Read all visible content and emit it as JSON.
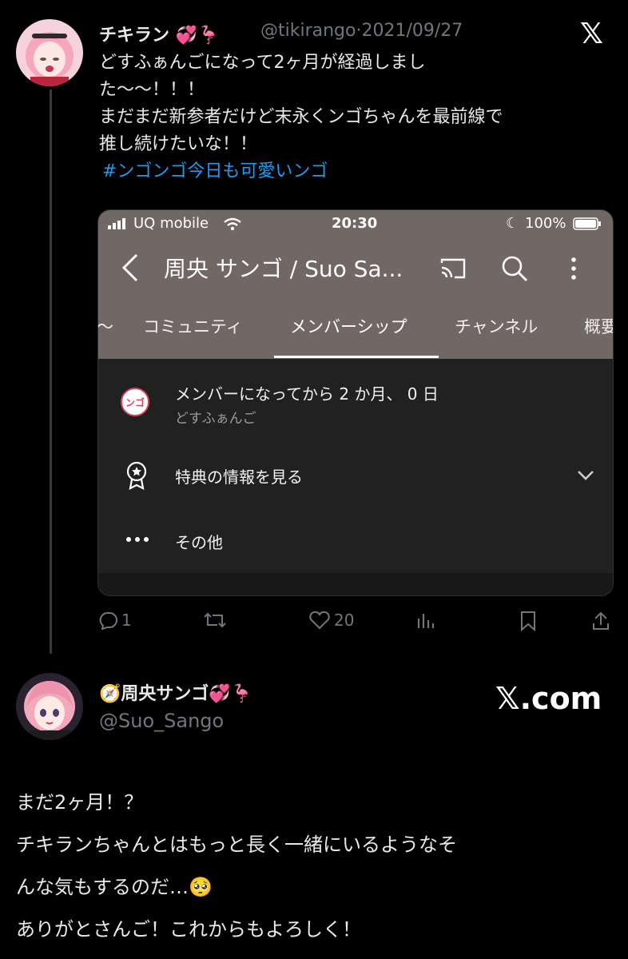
{
  "post": {
    "display_name": "チキラン",
    "emoji": "💞🦩",
    "handle": "@tikirango",
    "separator": "·",
    "date": "2021/09/27",
    "lines": [
      "どすふぁんごになって2ヶ月が経過しまし",
      "た〜〜！！！",
      "まだまだ新参者だけど末永くンゴちゃんを最前線で",
      "推し続けたいな！！"
    ],
    "hashtag": "#ンゴンゴ今日も可愛いンゴ",
    "logo": "𝕏"
  },
  "screenshot": {
    "carrier": "UQ mobile",
    "time": "20:30",
    "battery": "100%",
    "channel_title": "周央 サンゴ / Suo Sa...",
    "tabs": [
      "〜",
      "コミュニティ",
      "メンバーシップ",
      "チャンネル",
      "概要"
    ],
    "member_line": "メンバーになってから 2 か月、 0 日",
    "member_name": "どすふぁんご",
    "badge_text": "ンゴ",
    "perks_label": "特典の情報を見る",
    "other_label": "その他"
  },
  "actions": {
    "replies": "1",
    "likes": "20"
  },
  "reply": {
    "display_name": "周央サンゴ",
    "emoji_prefix": "🧭",
    "emoji_suffix": "💞🦩",
    "handle": "@Suo_Sango",
    "site": "𝕏.com",
    "lines": [
      "まだ2ヶ月！？",
      "チキランちゃんとはもっと長く一緒にいるようなそ",
      "んな気もするのだ…🥺",
      "ありがとさんご！これからもよろしく！"
    ]
  },
  "colors": {
    "accent": "#1d9bf0",
    "secondary": "#71767b",
    "yt_header": "#716765",
    "yt_body": "#212121"
  }
}
